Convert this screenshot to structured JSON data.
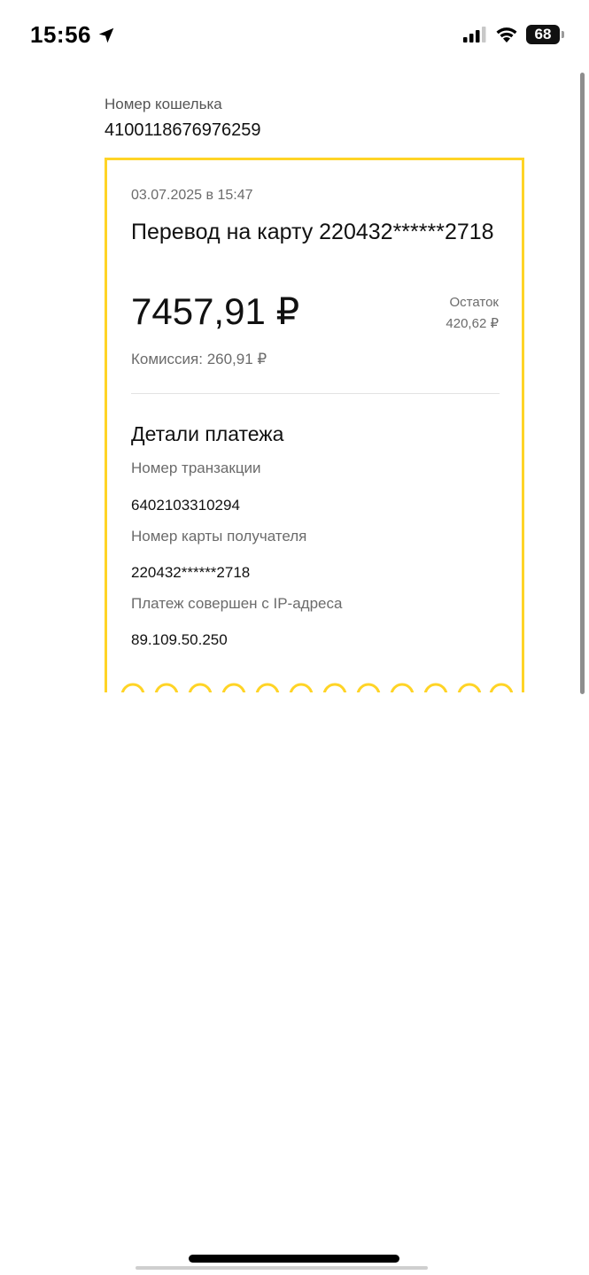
{
  "status_bar": {
    "time": "15:56",
    "battery": "68",
    "icons": [
      "location-arrow-icon",
      "signal-icon",
      "wifi-icon",
      "battery-icon"
    ]
  },
  "wallet": {
    "label": "Номер кошелька",
    "number": "4100118676976259"
  },
  "receipt": {
    "date": "03.07.2025 в 15:47",
    "title": "Перевод на карту 220432******2718",
    "amount": "7457,91 ₽",
    "balance_label": "Остаток",
    "balance_value": "420,62 ₽",
    "commission": "Комиссия: 260,91 ₽",
    "details_title": "Детали платежа",
    "fields": [
      {
        "label": "Номер транзакции",
        "value": "6402103310294"
      },
      {
        "label": "Номер карты получателя",
        "value": "220432******2718"
      },
      {
        "label": "Платеж совершен с IP-адреса",
        "value": "89.109.50.250"
      }
    ]
  },
  "colors": {
    "accent_yellow": "#ffd426",
    "text_primary": "#111111",
    "text_secondary": "#6b6b6b"
  }
}
